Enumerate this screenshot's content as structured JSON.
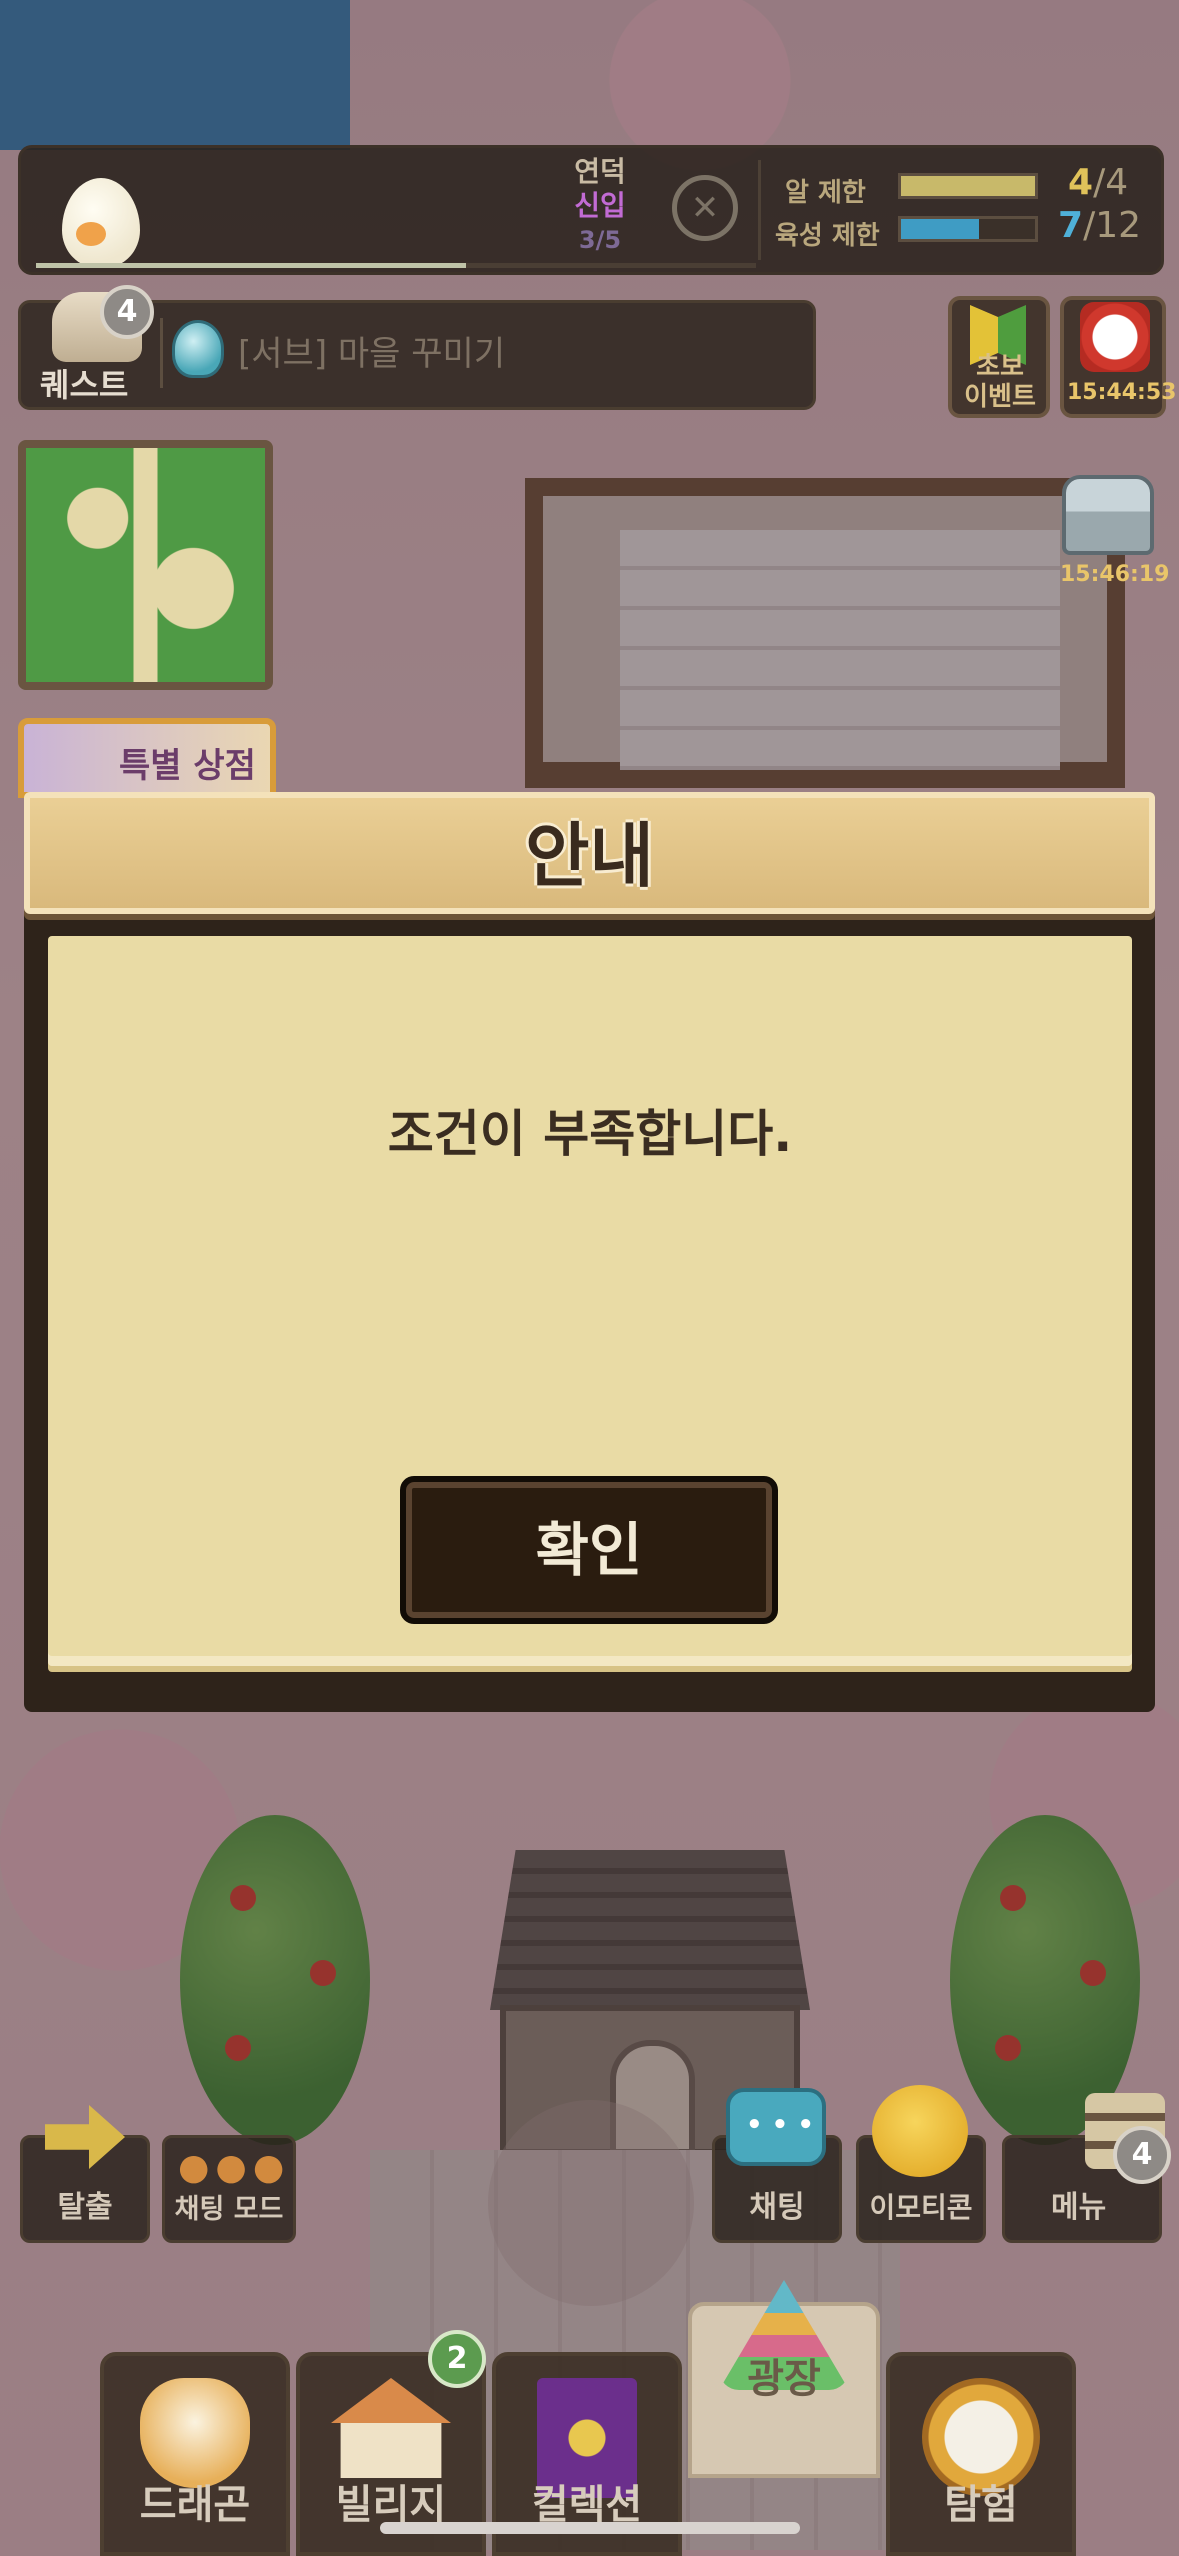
{
  "hud": {
    "yeondeok_label": "연덕",
    "yeondeok_sub": "신입",
    "yeondeok_count": "3/5",
    "egg_limit_label": "알 제한",
    "egg_limit_value": "4",
    "egg_limit_max": "/4",
    "egg_limit_fill": 1.0,
    "raise_limit_label": "육성 제한",
    "raise_limit_value": "7",
    "raise_limit_max": "/12",
    "raise_limit_fill": 0.58
  },
  "quest": {
    "label": "퀘스트",
    "badge": "4",
    "text": "[서브] 마을 꾸미기"
  },
  "events": {
    "beginner_label_1": "초보",
    "beginner_label_2": "이벤트",
    "timer_1": "15:44:53",
    "timer_2": "15:46:19"
  },
  "event_card_text": "특별 상점",
  "quick_buttons": {
    "escape": "탈출",
    "chat_mode": "채팅 모드",
    "chat": "채팅",
    "emoticon": "이모티콘",
    "menu": "메뉴",
    "menu_badge": "4"
  },
  "nav": {
    "tabs": [
      {
        "label": "드래곤"
      },
      {
        "label": "빌리지",
        "badge": "2"
      },
      {
        "label": "컬렉션"
      },
      {
        "label": "광장"
      },
      {
        "label": "탐험"
      }
    ]
  },
  "modal": {
    "title": "안내",
    "message": "조건이 부족합니다.",
    "confirm_label": "확인"
  },
  "colors": {
    "egg_bar": "#c8b96a",
    "raise_bar": "#3f9cc4",
    "egg_value": "#e0c25a",
    "raise_value": "#4fb0d8"
  }
}
